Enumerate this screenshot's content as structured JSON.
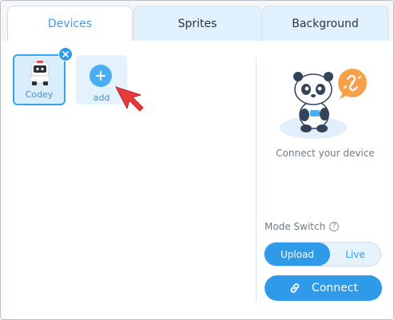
{
  "tabs": [
    {
      "label": "Devices",
      "active": true
    },
    {
      "label": "Sprites",
      "active": false
    },
    {
      "label": "Background",
      "active": false
    }
  ],
  "devices": {
    "items": [
      {
        "label": "Codey",
        "selected": true,
        "icon": "codey-robot-icon"
      }
    ],
    "remove_icon": "close-icon",
    "add": {
      "label": "add",
      "icon": "plus-icon"
    }
  },
  "connection": {
    "illustration": "panda-disconnected-illustration",
    "hint": "Connect your device",
    "mode_switch": {
      "label": "Mode Switch",
      "help_icon": "?",
      "options": [
        "Upload",
        "Live"
      ],
      "selected": "Upload"
    },
    "connect_button": {
      "label": "Connect",
      "icon": "link-icon"
    }
  },
  "colors": {
    "accent": "#2f9be8",
    "tab_inactive_bg": "#e1f1fd",
    "tile_bg": "#e4f2fd",
    "cursor": "#e83a3a",
    "badge_orange": "#f7a04a"
  }
}
